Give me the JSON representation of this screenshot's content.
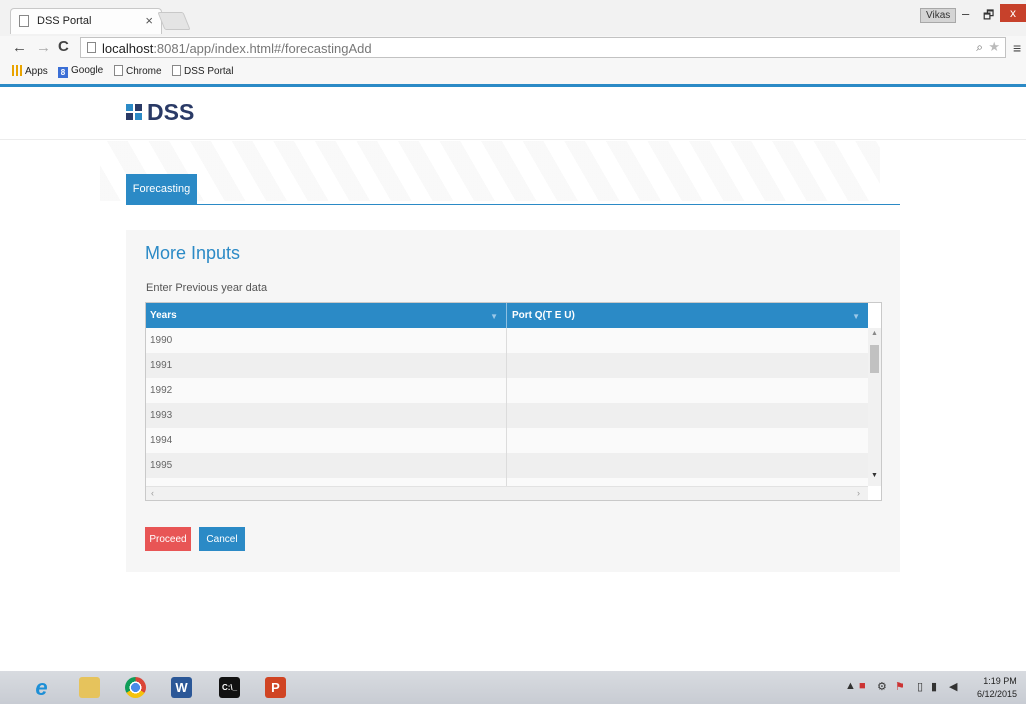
{
  "browser": {
    "tab_title": "DSS Portal",
    "tab_close": "×",
    "user_badge": "Vikas",
    "window_controls": {
      "minimize": "–",
      "maximize": "🗗",
      "close": "x"
    },
    "url_host": "localhost",
    "url_rest": ":8081/app/index.html#/forecastingAdd",
    "bookmarks": [
      "Apps",
      "Google",
      "Chrome",
      "DSS Portal"
    ],
    "google_glyph": "8"
  },
  "brand": {
    "name": "DSS",
    "accent": "#2b8ac6",
    "navy": "#2a3a66"
  },
  "nav": {
    "tabs": [
      {
        "label": "Forecasting",
        "active": true
      }
    ]
  },
  "form": {
    "title": "More Inputs",
    "subtitle": "Enter Previous year data",
    "table": {
      "columns": [
        "Years",
        "Port Q(T E U)"
      ],
      "rows": [
        {
          "year": "1990",
          "value": ""
        },
        {
          "year": "1991",
          "value": ""
        },
        {
          "year": "1992",
          "value": ""
        },
        {
          "year": "1993",
          "value": ""
        },
        {
          "year": "1994",
          "value": ""
        },
        {
          "year": "1995",
          "value": ""
        },
        {
          "year": "",
          "value": ""
        }
      ]
    },
    "buttons": {
      "proceed": "Proceed",
      "cancel": "Cancel"
    },
    "button_colors": {
      "proceed": "#e85555",
      "cancel": "#2b8ac6"
    }
  },
  "taskbar": {
    "apps": [
      "internet-explorer",
      "file-explorer",
      "chrome",
      "word",
      "command-prompt",
      "powerpoint"
    ],
    "ie_glyph": "e",
    "word_glyph": "W",
    "cmd_glyph": "C:\\_",
    "ppt_glyph": "P",
    "clock_time": "1:19 PM",
    "clock_date": "6/12/2015"
  }
}
